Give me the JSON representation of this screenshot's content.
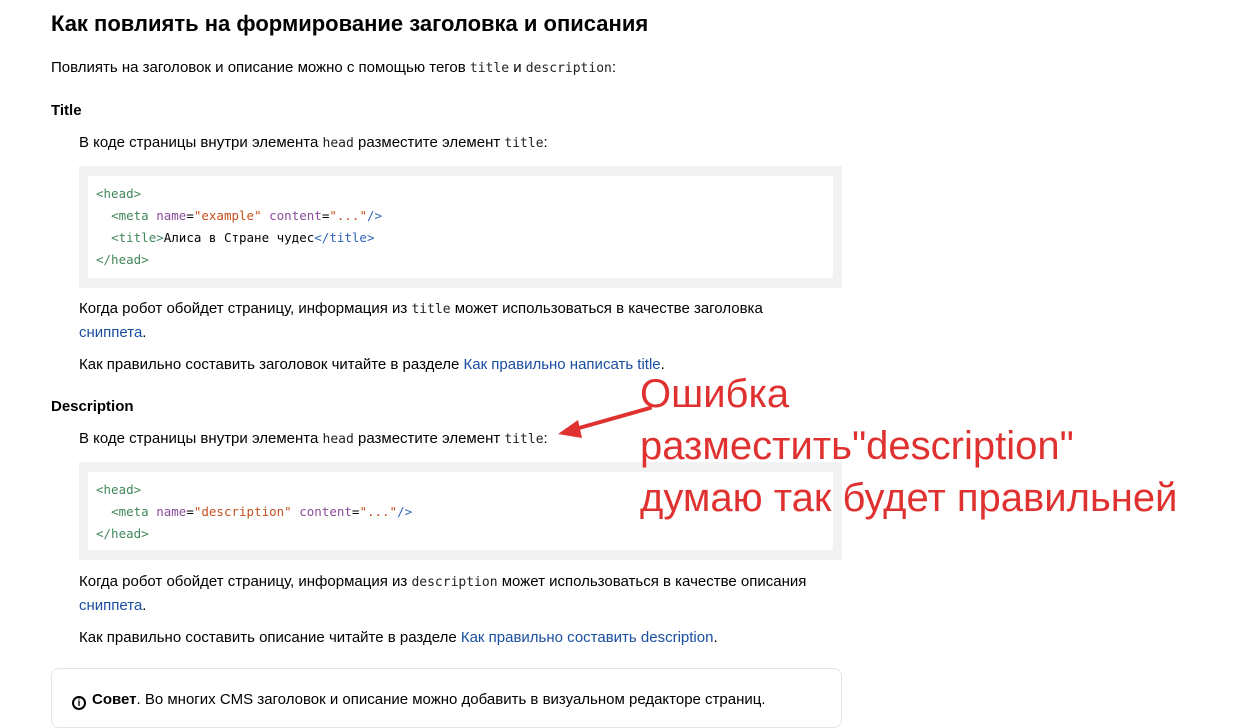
{
  "heading": "Как повлиять на формирование заголовка и описания",
  "intro": {
    "before": "Повлиять на заголовок и описание можно с помощью тегов ",
    "code1": "title",
    "mid": " и ",
    "code2": "description",
    "after": ":"
  },
  "title_section": {
    "heading": "Title",
    "instr_before": "В коде страницы внутри элемента ",
    "instr_code1": "head",
    "instr_mid": " разместите элемент ",
    "instr_code2": "title",
    "instr_after": ":",
    "code_lines": [
      {
        "indent": "",
        "parts": [
          [
            "tag",
            "<head>"
          ]
        ]
      },
      {
        "indent": "  ",
        "parts": [
          [
            "tag",
            "<meta "
          ],
          [
            "attr",
            "name"
          ],
          [
            "plain",
            "="
          ],
          [
            "val",
            "\"example\""
          ],
          [
            "plain",
            " "
          ],
          [
            "attr",
            "content"
          ],
          [
            "plain",
            "="
          ],
          [
            "val",
            "\"...\""
          ],
          [
            "bl",
            "/>"
          ]
        ]
      },
      {
        "indent": "  ",
        "parts": [
          [
            "tag",
            "<title>"
          ],
          [
            "plain",
            "Алиса в Стране чудес"
          ],
          [
            "bl",
            "</title>"
          ]
        ]
      },
      {
        "indent": "",
        "parts": [
          [
            "tag",
            "</head>"
          ]
        ]
      }
    ],
    "robot_before": "Когда робот обойдет страницу, информация из ",
    "robot_code": "title",
    "robot_after": " может использоваться в качестве заголовка",
    "snippet_link": "сниппета",
    "snippet_after": ".",
    "howto_before": "Как правильно составить заголовок читайте в разделе ",
    "howto_link": "Как правильно написать title",
    "howto_after": "."
  },
  "description_section": {
    "heading": "Description",
    "instr_before": "В коде страницы внутри элемента ",
    "instr_code1": "head",
    "instr_mid": " разместите элемент ",
    "instr_code2": "title",
    "instr_after": ":",
    "code_lines": [
      {
        "indent": "",
        "parts": [
          [
            "tag",
            "<head>"
          ]
        ]
      },
      {
        "indent": "  ",
        "parts": [
          [
            "tag",
            "<meta "
          ],
          [
            "attr",
            "name"
          ],
          [
            "plain",
            "="
          ],
          [
            "val",
            "\"description\""
          ],
          [
            "plain",
            " "
          ],
          [
            "attr",
            "content"
          ],
          [
            "plain",
            "="
          ],
          [
            "val",
            "\"...\""
          ],
          [
            "bl",
            "/>"
          ]
        ]
      },
      {
        "indent": "",
        "parts": [
          [
            "tag",
            "</head>"
          ]
        ]
      }
    ],
    "robot_before": "Когда робот обойдет страницу, информация из ",
    "robot_code": "description",
    "robot_after": " может использоваться в качестве описания",
    "snippet_link": "сниппета",
    "snippet_after": ".",
    "howto_before": "Как правильно составить описание читайте в разделе ",
    "howto_link": "Как правильно составить description",
    "howto_after": "."
  },
  "tip": {
    "icon": "info-icon",
    "label": "Совет",
    "text": ". Во многих CMS заголовок и описание можно добавить в визуальном редакторе страниц."
  },
  "annotation": {
    "lines": [
      "Ошибка",
      "разместить\"description\"",
      "думаю так будет правильней"
    ],
    "color": "#e03131"
  },
  "colors": {
    "link": "#1a4ea0",
    "annotation": "#e03131"
  }
}
